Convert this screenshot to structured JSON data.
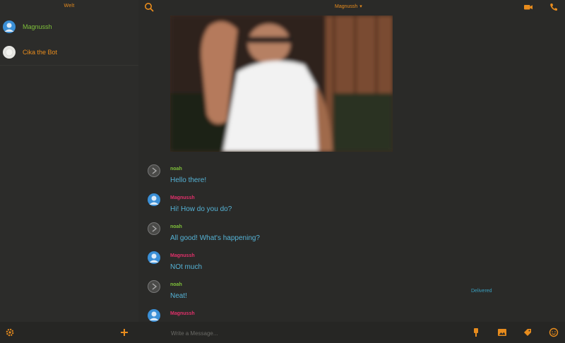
{
  "sidebar": {
    "title": "Welt",
    "contacts": [
      {
        "name": "Magnussh",
        "avatar": "blue-person-avatar",
        "color": "#7fc13a"
      },
      {
        "name": "Cika the Bot",
        "avatar": "white-bot-avatar",
        "color": "#e88c1d"
      }
    ]
  },
  "header": {
    "chat_title": "Magnussh",
    "chevron": "▾",
    "icons": [
      "search-icon",
      "video-call-icon",
      "phone-icon"
    ]
  },
  "messages": [
    {
      "sender": "noah",
      "text": "Hello there!",
      "sender_color": "#7fc13a",
      "avatar": "user-avatar"
    },
    {
      "sender": "Magnussh",
      "text": "Hi! How do you do?",
      "sender_color": "#e0306a",
      "avatar": "contact-avatar"
    },
    {
      "sender": "noah",
      "text": "All good! What's happening?",
      "sender_color": "#7fc13a",
      "avatar": "user-avatar"
    },
    {
      "sender": "Magnussh",
      "text": "NOt much",
      "sender_color": "#e0306a",
      "avatar": "contact-avatar"
    },
    {
      "sender": "noah",
      "text": "Neat!",
      "sender_color": "#7fc13a",
      "avatar": "user-avatar",
      "status": "Delivered"
    },
    {
      "sender": "Magnussh",
      "text": "",
      "sender_color": "#e0306a",
      "avatar": "contact-avatar"
    }
  ],
  "composer": {
    "placeholder": "Write a Message..."
  },
  "colors": {
    "accent": "#e88c1d",
    "background": "#2a2a28",
    "message_text": "#55b3d6"
  }
}
